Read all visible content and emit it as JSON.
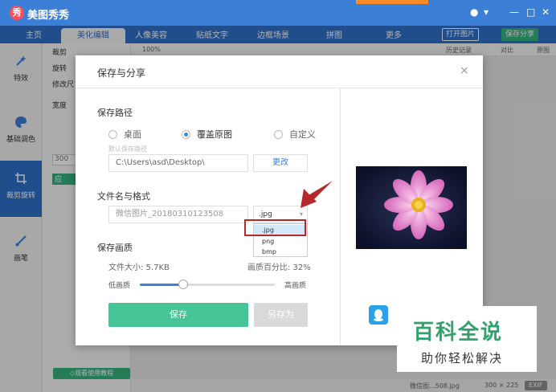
{
  "app": {
    "title": "美图秀秀",
    "logo_text": "秀",
    "window_controls": {
      "feedback": "●",
      "menu": "▾",
      "minimize": "—",
      "maximize": "□",
      "close": "✕"
    }
  },
  "nav": {
    "tabs": [
      {
        "label": "主页"
      },
      {
        "label": "美化编辑",
        "active": true
      },
      {
        "label": "人像美容"
      },
      {
        "label": "贴纸文字"
      },
      {
        "label": "边框场景"
      },
      {
        "label": "拼图"
      },
      {
        "label": "更多"
      }
    ],
    "open_image": "打开图片",
    "save_share": "保存分享"
  },
  "sidebar": {
    "items": [
      {
        "label": "特效",
        "icon": "magic-wand-icon"
      },
      {
        "label": "基础调色",
        "icon": "palette-icon"
      },
      {
        "label": "裁剪旋转",
        "icon": "crop-icon",
        "active": true
      },
      {
        "label": "画笔",
        "icon": "brush-icon"
      }
    ]
  },
  "panel": {
    "crop": "裁剪",
    "rotate": "旋转",
    "resize": "修改尺",
    "width_label": "宽度",
    "width_value": "300",
    "apply": "应",
    "tutorial": "◇观看使用教程"
  },
  "toolbar": {
    "zoom": "100%",
    "history": "历史记录",
    "compare": "对比",
    "original": "原图"
  },
  "status": {
    "filename": "微信图...508.jpg",
    "size": "300 × 225",
    "exif": "EXIF"
  },
  "dialog": {
    "title": "保存与分享",
    "close": "×",
    "save_path_title": "保存路径",
    "options": [
      {
        "label": "桌面",
        "selected": false
      },
      {
        "label": "覆盖原图",
        "selected": true
      },
      {
        "label": "自定义",
        "selected": false
      }
    ],
    "default_path_hint": "默认保存路径",
    "path_value": "C:\\Users\\asd\\Desktop\\",
    "change_button": "更改",
    "filename_title": "文件名与格式",
    "filename_value": "微信图片_20180310123508",
    "format_selected": ".jpg",
    "format_options": [
      ".jpg",
      "png",
      "bmp"
    ],
    "quality_title": "保存画质",
    "file_size_label": "文件大小: 5.7KB",
    "quality_percent_label": "画质百分比: 32%",
    "quality_percent": 32,
    "low_quality": "低画质",
    "high_quality": "高画质",
    "save_button": "保存",
    "save_as_button": "另存为"
  },
  "watermark": {
    "main": "百科全说",
    "sub": "助你轻松解决"
  },
  "colors": {
    "brand_blue": "#3b7fd6",
    "save_green": "#45c495",
    "highlight_red": "#b42a2a"
  }
}
